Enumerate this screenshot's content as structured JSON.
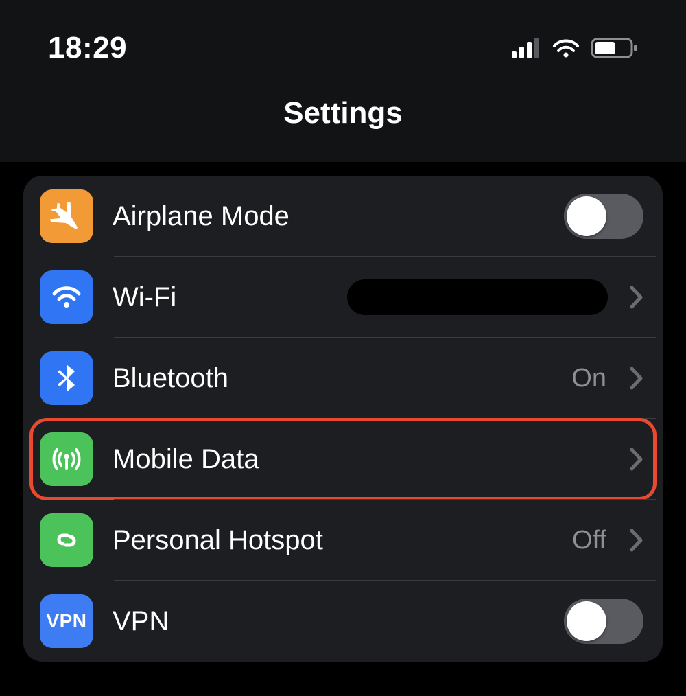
{
  "statusbar": {
    "time": "18:29"
  },
  "header": {
    "title": "Settings"
  },
  "items": [
    {
      "key": "airplane",
      "label": "Airplane Mode",
      "iconColor": "ic-orange",
      "iconName": "airplane-icon",
      "control": "toggle",
      "toggleOn": false
    },
    {
      "key": "wifi",
      "label": "Wi-Fi",
      "iconColor": "ic-blue",
      "iconName": "wifi-icon",
      "control": "disclosure",
      "redacted": true
    },
    {
      "key": "bluetooth",
      "label": "Bluetooth",
      "iconColor": "ic-blue",
      "iconName": "bluetooth-icon",
      "control": "disclosure",
      "value": "On"
    },
    {
      "key": "mobile",
      "label": "Mobile Data",
      "iconColor": "ic-green",
      "iconName": "antenna-icon",
      "control": "disclosure",
      "highlighted": true
    },
    {
      "key": "hotspot",
      "label": "Personal Hotspot",
      "iconColor": "ic-green",
      "iconName": "link-icon",
      "control": "disclosure",
      "value": "Off"
    },
    {
      "key": "vpn",
      "label": "VPN",
      "iconColor": "ic-bluev",
      "iconName": "vpn-icon",
      "control": "toggle",
      "toggleOn": false
    }
  ]
}
